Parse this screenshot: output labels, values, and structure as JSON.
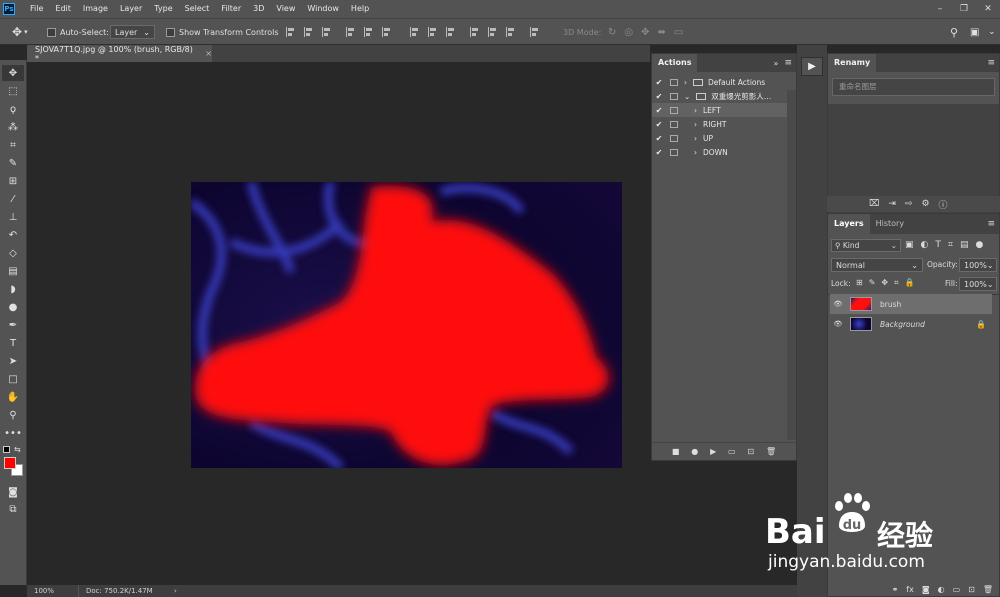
{
  "app": {
    "logo": "Ps"
  },
  "menu": [
    "File",
    "Edit",
    "Image",
    "Layer",
    "Type",
    "Select",
    "Filter",
    "3D",
    "View",
    "Window",
    "Help"
  ],
  "options": {
    "auto_select_label": "Auto-Select:",
    "auto_select_value": "Layer",
    "show_transform": "Show Transform Controls",
    "mode_3d": "3D Mode:"
  },
  "document": {
    "tab_title": "SJOVA7T1Q.jpg @ 100% (brush, RGB/8) *",
    "close": "×"
  },
  "status": {
    "zoom": "100%",
    "doc": "Doc: 750.2K/1.47M",
    "arrow": "›"
  },
  "actions_panel": {
    "title": "Actions",
    "rows": [
      {
        "check": "✔",
        "expander": "›",
        "folder": true,
        "label": "Default Actions"
      },
      {
        "check": "✔",
        "expander": "⌄",
        "folder": true,
        "label": "双重爆光剪影人…"
      },
      {
        "check": "✔",
        "expander": "›",
        "folder": false,
        "label": "LEFT"
      },
      {
        "check": "✔",
        "expander": "›",
        "folder": false,
        "label": "RIGHT"
      },
      {
        "check": "✔",
        "expander": "›",
        "folder": false,
        "label": "UP"
      },
      {
        "check": "✔",
        "expander": "›",
        "folder": false,
        "label": "DOWN"
      }
    ],
    "footer": [
      "■",
      "●",
      "▶",
      "▭",
      "⊡",
      "🗑"
    ]
  },
  "renamy_panel": {
    "title": "Renamy",
    "placeholder": "重命名图层"
  },
  "layers_panel": {
    "tabs": [
      "Layers",
      "History"
    ],
    "kind_label": "Kind",
    "blend_mode": "Normal",
    "opacity_label": "Opacity:",
    "opacity_value": "100%",
    "lock_label": "Lock:",
    "fill_label": "Fill:",
    "fill_value": "100%",
    "layers": [
      {
        "name": "brush",
        "selected": true
      },
      {
        "name": "Background",
        "selected": false,
        "locked": true
      }
    ]
  },
  "watermark": {
    "brand": "Bai",
    "brand2": "经验",
    "url": "jingyan.baidu.com"
  },
  "colors": {
    "foreground": "#ff0000",
    "background": "#ffffff",
    "accent": "#31a8ff"
  }
}
